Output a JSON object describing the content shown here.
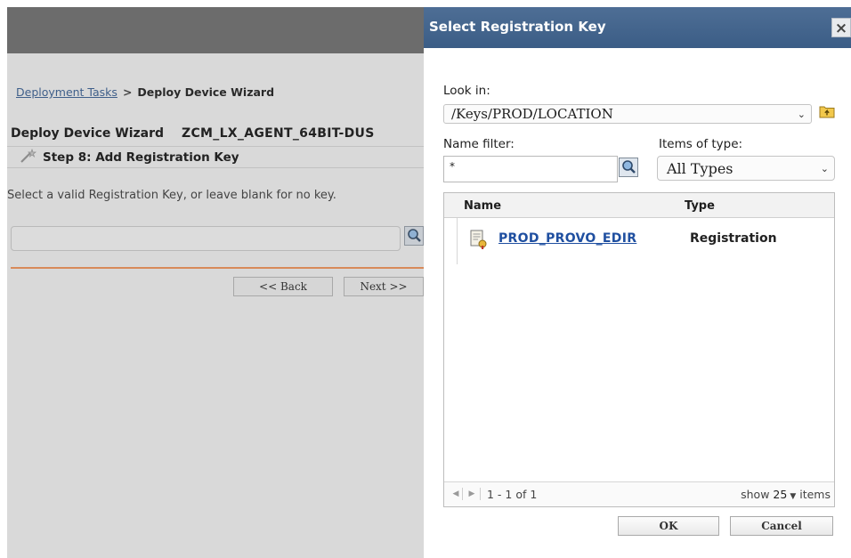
{
  "background_page": {
    "breadcrumb": {
      "link": "Deployment Tasks",
      "separator": ">",
      "current": "Deploy Device Wizard"
    },
    "wizard_title": "Deploy Device Wizard",
    "wizard_target": "ZCM_LX_AGENT_64BIT-DUS",
    "step_title": "Step 8: Add Registration Key",
    "instruction": "Select a valid Registration Key, or leave blank for no key.",
    "back_button": "<< Back",
    "next_button": "Next >>"
  },
  "dialog": {
    "title": "Select Registration Key",
    "close_glyph": "×",
    "look_in_label": "Look in:",
    "look_in_value": "/Keys/PROD/LOCATION",
    "name_filter_label": "Name filter:",
    "name_filter_value": "*",
    "items_of_type_label": "Items of type:",
    "items_of_type_value": "All Types",
    "columns": {
      "name": "Name",
      "type": "Type"
    },
    "rows": [
      {
        "name": "PROD_PROVO_EDIR",
        "type": "Registration"
      }
    ],
    "pager": {
      "range": "1 - 1 of 1",
      "show_label": "show",
      "page_size": "25",
      "items_label": "items"
    },
    "ok_button": "OK",
    "cancel_button": "Cancel"
  },
  "colors": {
    "title_bar": "#3f6089",
    "link": "#1f4fa0",
    "divider_accent": "#d88a5a",
    "background_dim": "#d9d9d9"
  },
  "icons": [
    "wand-icon",
    "search-icon",
    "folder-up-icon",
    "registration-key-icon",
    "chevron-down-icon",
    "close-icon"
  ]
}
